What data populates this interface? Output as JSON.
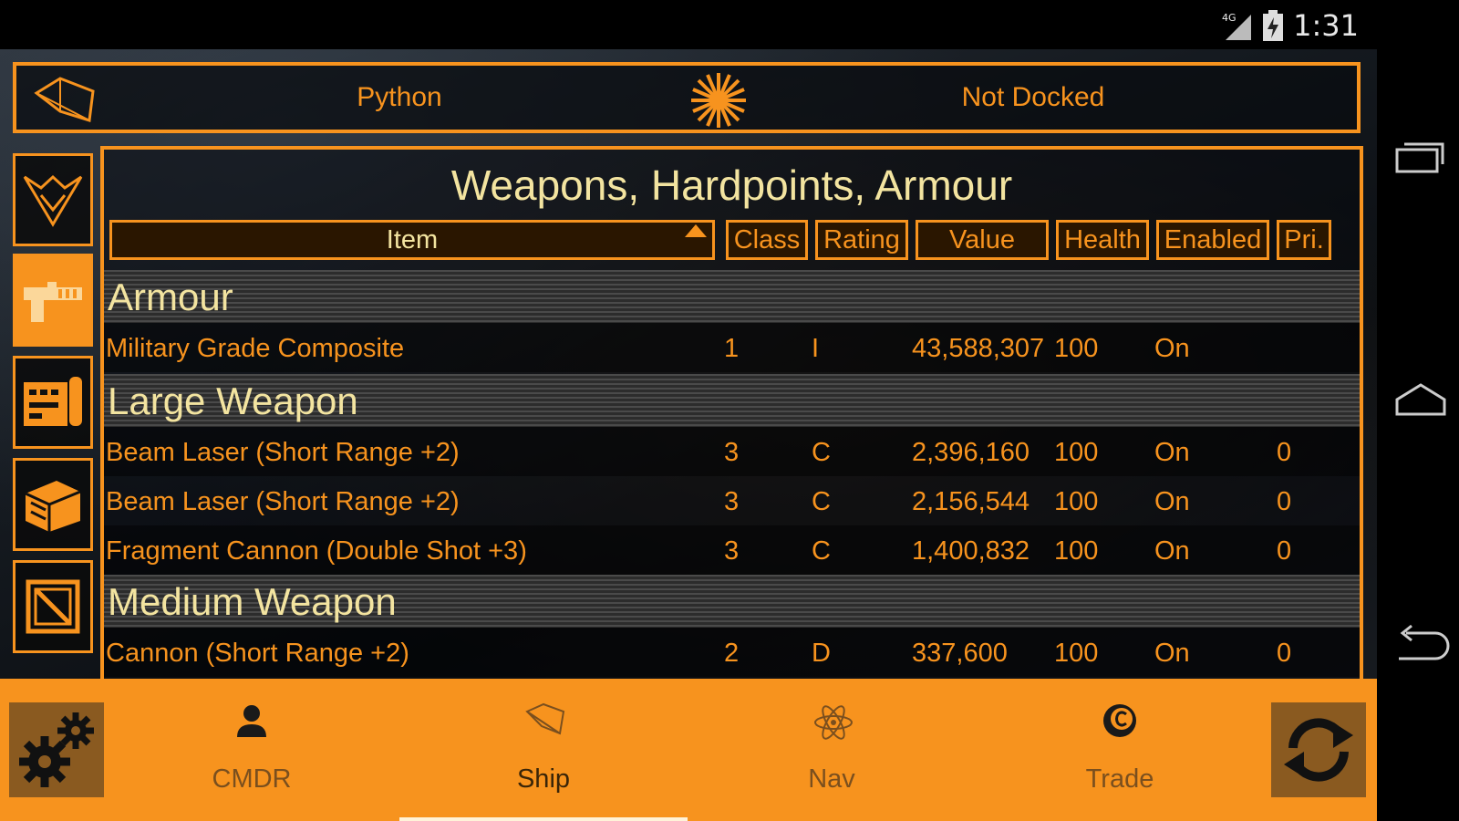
{
  "status_bar": {
    "network": "4G",
    "time": "1:31"
  },
  "top_bar": {
    "ship_name": "Python",
    "dock_status": "Not Docked"
  },
  "sidebar": {
    "items": [
      {
        "name": "elite-emblem",
        "active": false
      },
      {
        "name": "weapons",
        "active": true
      },
      {
        "name": "modules",
        "active": false
      },
      {
        "name": "cargo",
        "active": false
      },
      {
        "name": "crate",
        "active": false
      }
    ]
  },
  "panel": {
    "title": "Weapons, Hardpoints, Armour",
    "columns": {
      "item": "Item",
      "class": "Class",
      "rating": "Rating",
      "value": "Value",
      "health": "Health",
      "enabled": "Enabled",
      "priority": "Pri."
    },
    "groups": [
      {
        "label": "Armour",
        "rows": [
          {
            "item": "Military Grade Composite",
            "class": "1",
            "rating": "I",
            "value": "43,588,307",
            "health": "100",
            "enabled": "On",
            "priority": ""
          }
        ]
      },
      {
        "label": "Large Weapon",
        "rows": [
          {
            "item": "Beam Laser (Short Range +2)",
            "class": "3",
            "rating": "C",
            "value": "2,396,160",
            "health": "100",
            "enabled": "On",
            "priority": "0"
          },
          {
            "item": "Beam Laser (Short Range +2)",
            "class": "3",
            "rating": "C",
            "value": "2,156,544",
            "health": "100",
            "enabled": "On",
            "priority": "0"
          },
          {
            "item": "Fragment Cannon (Double Shot +3)",
            "class": "3",
            "rating": "C",
            "value": "1,400,832",
            "health": "100",
            "enabled": "On",
            "priority": "0"
          }
        ]
      },
      {
        "label": "Medium Weapon",
        "rows": [
          {
            "item": "Cannon (Short Range +2)",
            "class": "2",
            "rating": "D",
            "value": "337,600",
            "health": "100",
            "enabled": "On",
            "priority": "0"
          }
        ]
      }
    ]
  },
  "bottom_tabs": [
    {
      "label": "CMDR",
      "icon": "person-icon",
      "active": false
    },
    {
      "label": "Ship",
      "icon": "ship-icon",
      "active": true
    },
    {
      "label": "Nav",
      "icon": "atom-icon",
      "active": false
    },
    {
      "label": "Trade",
      "icon": "credits-icon",
      "active": false
    }
  ],
  "colors": {
    "accent": "#f7931e",
    "title_text": "#f3e4a0",
    "background": "#0c0f13"
  }
}
